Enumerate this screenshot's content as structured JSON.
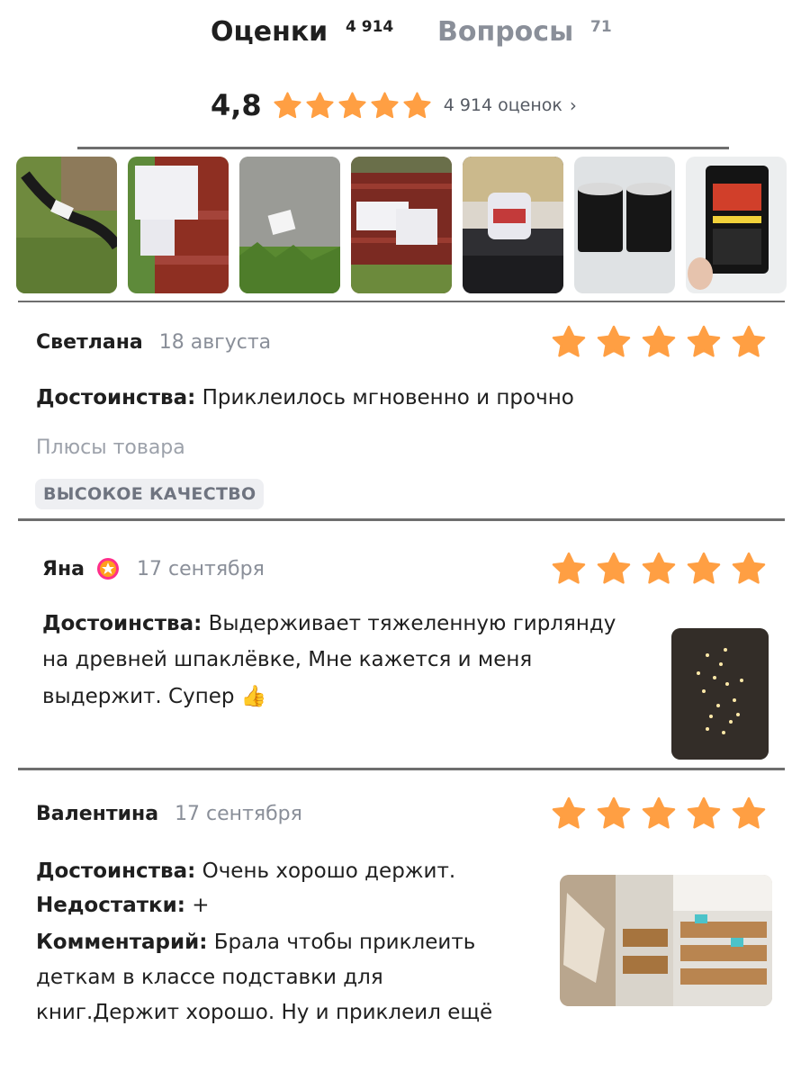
{
  "tabs": {
    "reviews_label": "Оценки",
    "reviews_count": "4 914",
    "questions_label": "Вопросы",
    "questions_count": "71"
  },
  "summary": {
    "rating": "4,8",
    "stars": 5,
    "count_text": "4 914 оценок",
    "chevron": "›"
  },
  "colors": {
    "star": "#ff9f43",
    "badge": "#ff2e8a"
  },
  "photos": [
    {
      "icon": "photo-hose-on-grass"
    },
    {
      "icon": "photo-red-barrel-patch"
    },
    {
      "icon": "photo-concrete-patch"
    },
    {
      "icon": "photo-red-barrel-tape"
    },
    {
      "icon": "photo-tape-roll-car"
    },
    {
      "icon": "photo-two-black-rolls"
    },
    {
      "icon": "photo-flex-tape-can"
    }
  ],
  "reviews": [
    {
      "author": "Светлана",
      "date": "18 августа",
      "stars": 5,
      "merits_label": "Достоинства:",
      "merits_text": " Приклеилось мгновенно и прочно",
      "plus_label": "Плюсы товара",
      "tag": "ВЫСОКОЕ КАЧЕСТВО"
    },
    {
      "author": "Яна",
      "date": "17 сентября",
      "stars": 5,
      "merits_label": "Достоинства:",
      "merits_lines": [
        " Выдерживает тяжеленную гирлянду",
        "на древней шпаклёвке, Мне кажется и меня",
        "выдержит. Супер 👍"
      ],
      "photo_icon": "photo-garland-lights"
    },
    {
      "author": "Валентина",
      "date": "17 сентября",
      "stars": 5,
      "merits_label": "Достоинства:",
      "merits_text": " Очень хорошо держит.",
      "cons_label": "Недостатки:",
      "cons_text": " +",
      "comment_label": "Комментарий:",
      "comment_lines": [
        " Брала чтобы приклеить",
        "деткам в классе подставки для",
        "книг.Держит хорошо. Ну и приклеил   ещё"
      ],
      "photo_icon": "photo-classroom"
    }
  ]
}
